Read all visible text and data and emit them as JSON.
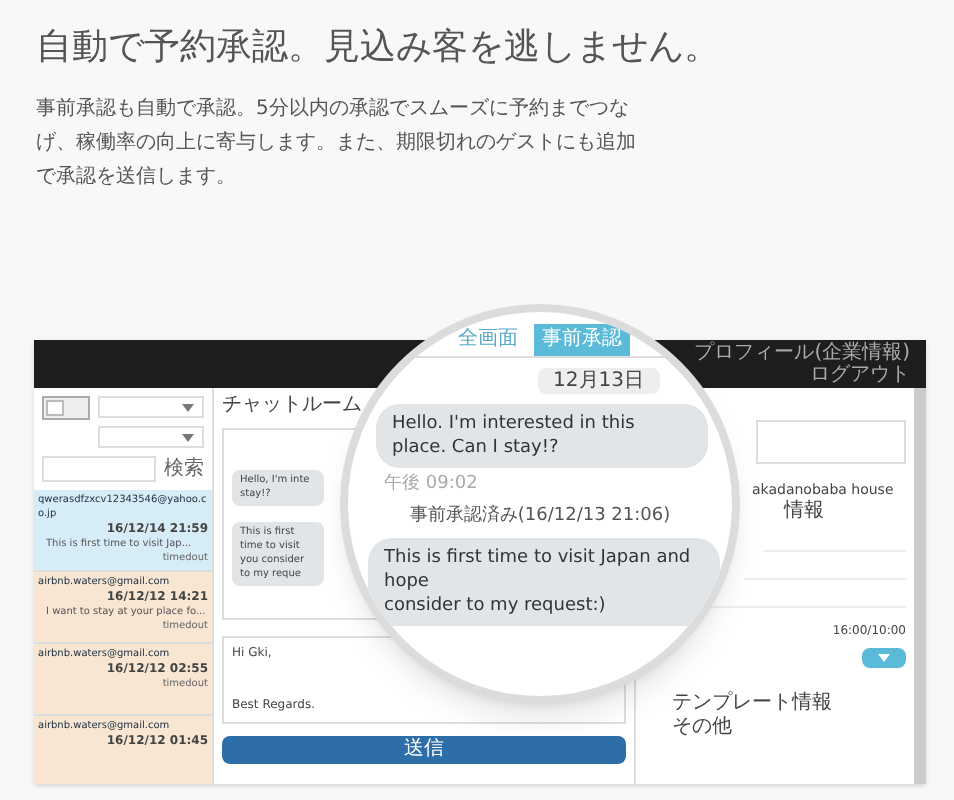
{
  "headline": "自動で予約承認。見込み客を逃しません。",
  "intro": "事前承認も自動で承認。5分以内の承認でスムーズに予約までつなげ、稼働率の向上に寄与します。また、期限切れのゲストにも追加で承認を送信します。",
  "app": {
    "top_bar": [
      "プロフィール(企業情報)",
      "ログアウト"
    ],
    "sidebar": {
      "toggle": {
        "on": false
      },
      "search_button": "検索",
      "conversations": [
        {
          "email": "qwerasdfzxcv12343546@yahoo.co.jp",
          "date": "16/12/14 21:59",
          "preview": "This is first time to visit Jap...",
          "status": "timedout",
          "selected": true
        },
        {
          "email": "airbnb.waters@gmail.com",
          "date": "16/12/12 14:21",
          "preview": "I want to stay at your place fo...",
          "status": "timedout",
          "selected": false
        },
        {
          "email": "airbnb.waters@gmail.com",
          "date": "16/12/12 02:55",
          "status": "timedout",
          "selected": false
        },
        {
          "email": "airbnb.waters@gmail.com",
          "date": "16/12/12 01:45",
          "selected": false
        }
      ]
    },
    "chat": {
      "title": "チャットルーム",
      "bubbles": [
        "Hello, I'm inte stay!?",
        "This is first time to visit you consider to my reque"
      ],
      "compose": [
        "Hi Gki,",
        "Best Regards."
      ],
      "send_button": "送信"
    },
    "details": {
      "listing": "akadanobaba house",
      "section": "情報",
      "time": "16:00/10:00",
      "template_title": "テンプレート情報",
      "template_item": "その他"
    }
  },
  "magnifier": {
    "tabs": [
      {
        "label": "全画面",
        "selected": false
      },
      {
        "label": "事前承認",
        "selected": true
      }
    ],
    "date": "12月13日",
    "first_message": {
      "text": "Hello. I'm interested in this place. Can I stay!?",
      "time": "午後 09:02"
    },
    "notice": "事前承認済み(16/12/13 21:06)",
    "second_message": [
      "This is first time to visit Japan and hope",
      "consider to my request:)"
    ]
  }
}
